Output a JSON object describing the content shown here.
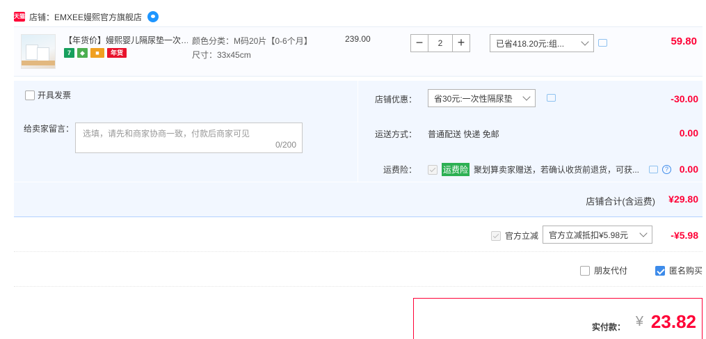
{
  "shop": {
    "tmall_badge": "天猫",
    "name": "店铺：EMXEE嫚熙官方旗舰店"
  },
  "item": {
    "title": "【年货价】嫚熙婴儿隔尿垫一次…",
    "badges": [
      "7",
      "",
      "",
      "年货"
    ],
    "sku_color": "颜色分类：M码20片【0-6个月】",
    "sku_size": "尺寸：33x45cm",
    "unit_price": "239.00",
    "quantity": "2",
    "minus": "−",
    "plus": "+",
    "discount_selected": "已省418.20元:组...",
    "total": "59.80"
  },
  "order": {
    "invoice_label": "开具发票",
    "memo_label": "给卖家留言：",
    "memo_placeholder": "选填，请先和商家协商一致，付款后商家可见",
    "memo_count": "0/200",
    "shop_coupon_label": "店铺优惠：",
    "shop_coupon_selected": "省30元:一次性隔尿垫",
    "shop_coupon_amount": "-30.00",
    "shipping_label": "运送方式：",
    "shipping_value": "普通配送 快递 免邮",
    "shipping_amount": "0.00",
    "insurance_label": "运费险：",
    "insurance_tag": "运费险",
    "insurance_desc": "聚划算卖家赠送，若确认收货前退货，可获...",
    "insurance_amount": "0.00",
    "help_glyph": "?",
    "subtotal_label": "店铺合计(含运费)",
    "subtotal_value": "¥29.80"
  },
  "official": {
    "label": "官方立减",
    "selected": "官方立减抵扣¥5.98元",
    "amount": "-¥5.98"
  },
  "options": {
    "friend_pay": "朋友代付",
    "anonymous": "匿名购买"
  },
  "payment": {
    "label": "实付款：",
    "yen": "¥",
    "amount": "23.82"
  },
  "colors": {
    "accent_red": "#ff0036",
    "panel_blue": "#f2f7ff",
    "link_blue": "#3d8bea"
  }
}
